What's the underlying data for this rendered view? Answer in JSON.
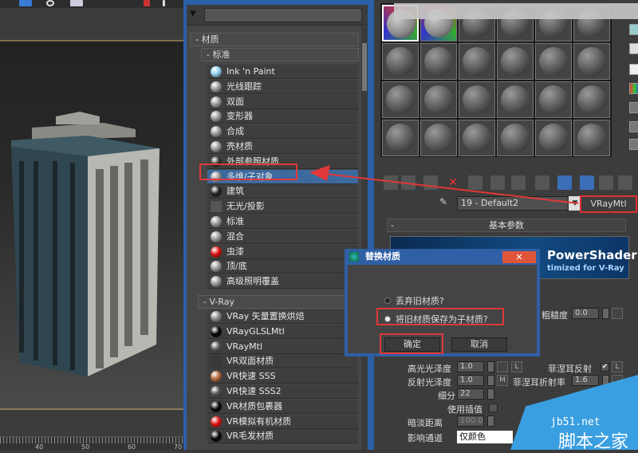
{
  "viewport": {
    "timeline_labels": [
      "40",
      "50",
      "60",
      "70"
    ]
  },
  "browser": {
    "search_placeholder": "",
    "groups": [
      {
        "label": "- 材质"
      },
      {
        "label": "- 标准"
      },
      {
        "label": "- V-Ray"
      }
    ],
    "standard_items": [
      {
        "label": "Ink 'n Paint",
        "icon": "ink-paint-swatch",
        "color": "#8fd0f0"
      },
      {
        "label": "光线跟踪",
        "icon": "raytrace-swatch",
        "color": "#999999"
      },
      {
        "label": "双面",
        "icon": "double-sided-swatch",
        "color": "#999999"
      },
      {
        "label": "变形器",
        "icon": "morpher-swatch",
        "color": "#999999"
      },
      {
        "label": "合成",
        "icon": "composite-swatch",
        "color": "#999999"
      },
      {
        "label": "壳材质",
        "icon": "shell-swatch",
        "color": "#999999"
      },
      {
        "label": "外部参照材质",
        "icon": "xref-swatch",
        "color": "#333333"
      },
      {
        "label": "多维/子对象",
        "icon": "multi-sub-swatch",
        "color": "#999999",
        "selected": true
      },
      {
        "label": "建筑",
        "icon": "architectural-swatch",
        "color": "#222222"
      },
      {
        "label": "无光/投影",
        "icon": "matte-shadow-swatch",
        "color": "#555555"
      },
      {
        "label": "标准",
        "icon": "standard-swatch",
        "color": "#999999"
      },
      {
        "label": "混合",
        "icon": "blend-swatch",
        "color": "#999999"
      },
      {
        "label": "虫漆",
        "icon": "shellac-swatch",
        "color": "#dd1010"
      },
      {
        "label": "顶/底",
        "icon": "top-bottom-swatch",
        "color": "#999999"
      },
      {
        "label": "高级照明覆盖",
        "icon": "adv-lighting-swatch",
        "color": "#999999"
      }
    ],
    "vray_items": [
      {
        "label": "VRay 矢量置换烘焙",
        "icon": "vray-vector-swatch",
        "color": "#888888"
      },
      {
        "label": "VRayGLSLMtl",
        "icon": "glsl-swatch",
        "color": "#050505"
      },
      {
        "label": "VRayMtl",
        "icon": "vraymtl-swatch",
        "color": "#555555"
      },
      {
        "label": "VR双面材质",
        "icon": "vr-2sided-swatch",
        "color": "#3a3a3a"
      },
      {
        "label": "VR快速 SSS",
        "icon": "vr-fastsss-swatch",
        "color": "#b06a38"
      },
      {
        "label": "VR快速 SSS2",
        "icon": "vr-fastsss2-swatch",
        "color": "#555555"
      },
      {
        "label": "VR材质包裹器",
        "icon": "vr-wrapper-swatch",
        "color": "#080808"
      },
      {
        "label": "VR模拟有机材质",
        "icon": "vr-organic-swatch",
        "color": "#dd1010"
      },
      {
        "label": "VR毛发材质",
        "icon": "vr-hair-swatch",
        "color": "#080808"
      }
    ]
  },
  "editor": {
    "material_name": "19 - Default2",
    "material_type": "VRayMtl",
    "rollout_title": "基本参数",
    "banner_title": "PowerShader",
    "banner_subtitle": "timized for V-Ray",
    "roughness_label": "粗糙度",
    "roughness_value": "0.0",
    "params": {
      "hilight_gloss_label": "高光光泽度",
      "hilight_gloss_value": "1.0",
      "refl_gloss_label": "反射光泽度",
      "refl_gloss_value": "1.0",
      "subdivs_label": "细分",
      "subdivs_value": "22",
      "use_interp_label": "使用插值",
      "dim_dist_label": "暗淡距离",
      "dim_dist_value": "100.0m",
      "affect_channels_label": "影响通道",
      "affect_channels_value": "仅颜色",
      "fresnel_label": "菲涅耳反射",
      "fresnel_checked": true,
      "fresnel_ior_label": "菲涅耳折射率",
      "fresnel_ior_value": "1.6",
      "l_label": "L",
      "m_label": "M"
    }
  },
  "dialog": {
    "title": "替换材质",
    "close_label": "✕",
    "options": [
      {
        "label": "丢弃旧材质?",
        "selected": false
      },
      {
        "label": "将旧材质保存为子材质?",
        "selected": true
      }
    ],
    "ok_label": "确定",
    "cancel_label": "取消"
  },
  "watermark": {
    "site": "jb51.net",
    "name": "脚本之家"
  },
  "colors": {
    "highlight": "#e03838",
    "window_blue": "#2b5fa8",
    "selection": "#3d6a9e"
  }
}
